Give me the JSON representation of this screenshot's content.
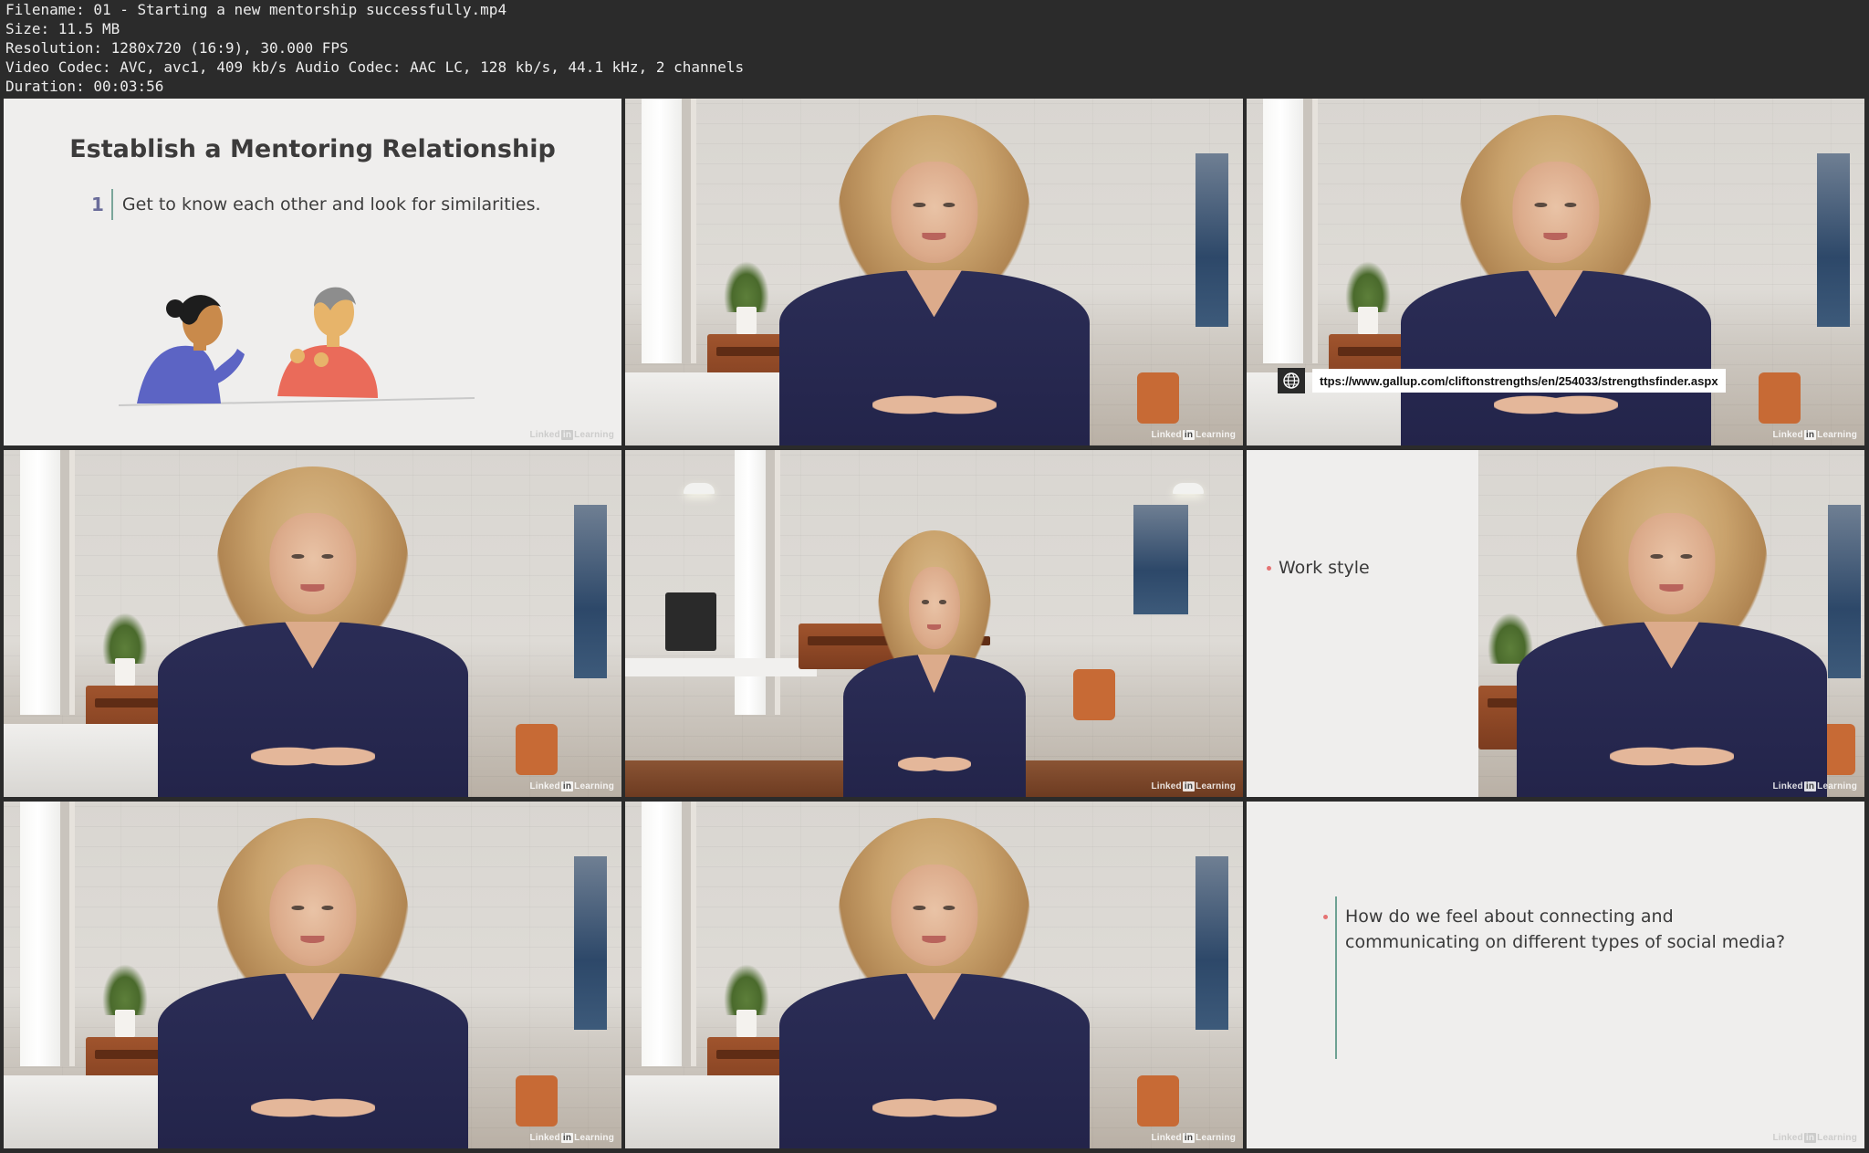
{
  "file_info": {
    "filename_line": "Filename: 01 - Starting a new mentorship successfully.mp4",
    "size_line": "Size: 11.5 MB",
    "resolution_line": "Resolution: 1280x720 (16:9), 30.000 FPS",
    "codec_line": "Video Codec: AVC, avc1, 409 kb/s Audio Codec: AAC LC, 128 kb/s, 44.1 kHz, 2 channels",
    "duration_line": "Duration: 00:03:56"
  },
  "thumbnails": [
    {
      "kind": "slide",
      "slide_title": "Establish a Mentoring Relationship",
      "point_number": "1",
      "point_text": "Get to know each other and look for similarities."
    },
    {
      "kind": "presenter"
    },
    {
      "kind": "presenter-url",
      "url": "ttps://www.gallup.com/cliftonstrengths/en/254033/strengthsfinder.aspx"
    },
    {
      "kind": "presenter"
    },
    {
      "kind": "presenter-wide"
    },
    {
      "kind": "split-slide",
      "bullet": "Work style"
    },
    {
      "kind": "presenter"
    },
    {
      "kind": "presenter"
    },
    {
      "kind": "question-slide",
      "question": "How do we feel about connecting and communicating on different types of social media?"
    }
  ],
  "watermark": {
    "brand_left": "Linked",
    "brand_in": "in",
    "brand_right": "Learning"
  },
  "colors": {
    "sheet_background": "#2b2b2b",
    "header_text": "#ececec",
    "slide_background": "#efeeed",
    "slide_accent_bar": "#7aa59a",
    "bullet_dot": "#e57373",
    "presenter_top": "#2b2d56"
  },
  "icons": {
    "url_overlay": "globe-icon"
  }
}
